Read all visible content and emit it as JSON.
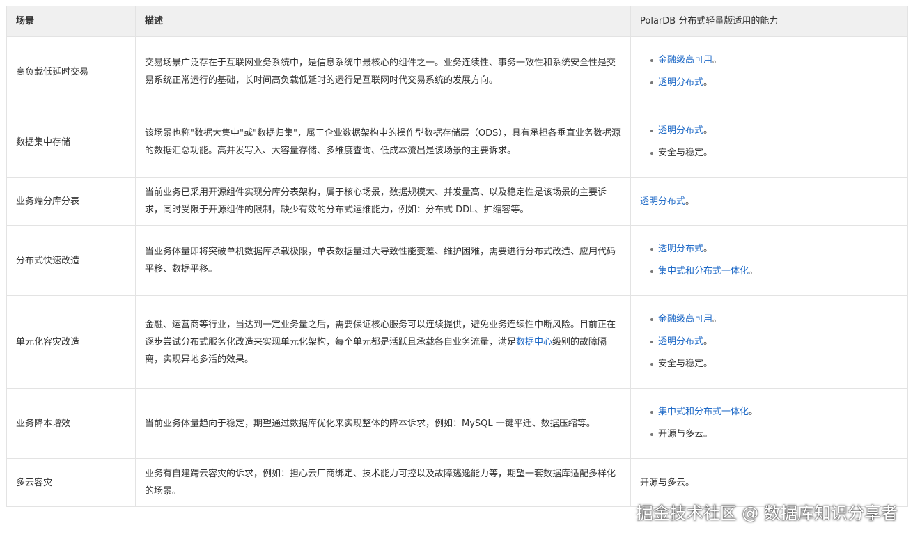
{
  "table": {
    "headers": [
      "场景",
      "描述",
      "PolarDB 分布式轻量版适用的能力"
    ],
    "rows": [
      {
        "scene": "高负载低延时交易",
        "desc": "交易场景广泛存在于互联网业务系统中，是信息系统中最核心的组件之一。业务连续性、事务一致性和系统安全性是交易系统正常运行的基础，长时间高负载低延时的运行是互联网时代交易系统的发展方向。",
        "caps": [
          {
            "text": "金融级高可用",
            "suffix": "。",
            "link": true
          },
          {
            "text": "透明分布式",
            "suffix": "。",
            "link": true
          }
        ]
      },
      {
        "scene": "数据集中存储",
        "desc": "该场景也称\"数据大集中\"或\"数据归集\"，属于企业数据架构中的操作型数据存储层（ODS），具有承担各垂直业务数据源的数据汇总功能。高并发写入、大容量存储、多维度查询、低成本流出是该场景的主要诉求。",
        "caps": [
          {
            "text": "透明分布式",
            "suffix": "。",
            "link": true
          },
          {
            "text": "安全与稳定",
            "suffix": "。",
            "link": false
          }
        ]
      },
      {
        "scene": "业务端分库分表",
        "desc": "当前业务已采用开源组件实现分库分表架构，属于核心场景，数据规模大、并发量高、以及稳定性是该场景的主要诉求，同时受限于开源组件的限制，缺少有效的分布式运维能力，例如：分布式 DDL、扩缩容等。",
        "cap_text": "透明分布式",
        "cap_suffix": "。"
      },
      {
        "scene": "分布式快速改造",
        "desc": "当业务体量即将突破单机数据库承载极限，单表数据量过大导致性能变差、维护困难，需要进行分布式改造、应用代码平移、数据平移。",
        "caps": [
          {
            "text": "透明分布式",
            "suffix": "。",
            "link": true
          },
          {
            "text": "集中式和分布式一体化",
            "suffix": "。",
            "link": true
          }
        ]
      },
      {
        "scene": "单元化容灾改造",
        "desc_a": "金融、运营商等行业，当达到一定业务量之后，需要保证核心服务可以连续提供，避免业务连续性中断风险。目前正在逐步尝试分布式服务化改造来实现单元化架构，每个单元都是活跃且承载各自业务流量，满足",
        "desc_link": "数据中心",
        "desc_b": "级别的故障隔离，实现异地多活的效果。",
        "caps": [
          {
            "text": "金融级高可用",
            "suffix": "。",
            "link": true
          },
          {
            "text": "透明分布式",
            "suffix": "。",
            "link": true
          },
          {
            "text": "安全与稳定",
            "suffix": "。",
            "link": false
          }
        ]
      },
      {
        "scene": "业务降本增效",
        "desc": "当前业务体量趋向于稳定，期望通过数据库优化来实现整体的降本诉求，例如：MySQL 一键平迁、数据压缩等。",
        "caps": [
          {
            "text": "集中式和分布式一体化",
            "suffix": "。",
            "link": true
          },
          {
            "text": "开源与多云",
            "suffix": "。",
            "link": false
          }
        ]
      },
      {
        "scene": "多云容灾",
        "desc": "业务有自建跨云容灾的诉求，例如：担心云厂商绑定、技术能力可控以及故障逃逸能力等，期望一套数据库适配多样化的场景。",
        "cap_text": "开源与多云",
        "cap_suffix": "。"
      }
    ]
  },
  "watermark": "掘金技术社区 @ 数据库知识分享者",
  "colors": {
    "link": "#1f6ac7",
    "header_bg": "#f0f0f0",
    "border": "#e3e3e3",
    "text": "#333333"
  }
}
